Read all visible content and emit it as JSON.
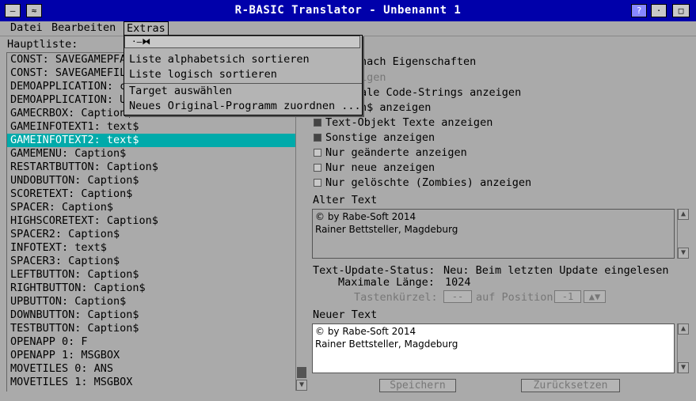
{
  "window": {
    "title": "R-BASIC Translator - Unbenannt 1"
  },
  "menu": {
    "datei": "Datei",
    "bearbeiten": "Bearbeiten",
    "extras": "Extras"
  },
  "dropdown": {
    "items": [
      "Liste alphabetsich sortieren",
      "Liste logisch sortieren",
      "Target auswählen",
      "Neues Original-Programm zuordnen ..."
    ]
  },
  "list": {
    "label": "Hauptliste:",
    "items": [
      "CONST: SAVEGAMEPFA",
      "CONST: SAVEGAMEFIL",
      "DEMOAPPLICATION: c",
      "DEMOAPPLICATION: U",
      "GAMECRBOX: Caption$",
      "GAMEINFOTEXT1: text$",
      "GAMEINFOTEXT2: text$",
      "GAMEMENU: Caption$",
      "RESTARTBUTTON: Caption$",
      "UNDOBUTTON: Caption$",
      "SCORETEXT: Caption$",
      "SPACER: Caption$",
      "HIGHSCORETEXT: Caption$",
      "SPACER2: Caption$",
      "INFOTEXT: text$",
      "SPACER3: Caption$",
      "LEFTBUTTON: Caption$",
      "RIGHTBUTTON: Caption$",
      "UPBUTTON: Caption$",
      "DOWNBUTTON: Caption$",
      "TESTBUTTON: Caption$",
      "OPENAPP 0: F",
      "OPENAPP 1: MSGBOX",
      "MOVETILES 0: ANS",
      "MOVETILES 1: MSGBOX"
    ]
  },
  "options": {
    "line1": "nach Eigenschaften",
    "line2": "igen",
    "line3": "ale Code-Strings anzeigen",
    "line4": "n$ anzeigen",
    "text_objekt": "Text-Objekt Texte anzeigen",
    "sonstige": "Sonstige anzeigen",
    "geaenderte": "Nur geänderte anzeigen",
    "neue": "Nur neue anzeigen",
    "geloeschte": "Nur gelöschte (Zombies) anzeigen"
  },
  "alter_text": {
    "label": "Alter Text",
    "line1": "© by Rabe-Soft 2014",
    "line2": "Rainer Bettsteller, Magdeburg"
  },
  "status": {
    "label": "Text-Update-Status:",
    "value": "Neu: Beim letzten Update eingelesen",
    "maxlen_label": "Maximale Länge:",
    "maxlen_value": "1024",
    "tasten_label": "Tastenkürzel:",
    "tasten_value": "--",
    "pos_label": "auf Position",
    "pos_value": "-1"
  },
  "neuer_text": {
    "label": "Neuer Text",
    "line1": "© by Rabe-Soft 2014",
    "line2": "Rainer Bettsteller, Magdeburg"
  },
  "buttons": {
    "save": "Speichern",
    "reset": "Zurücksetzen"
  }
}
